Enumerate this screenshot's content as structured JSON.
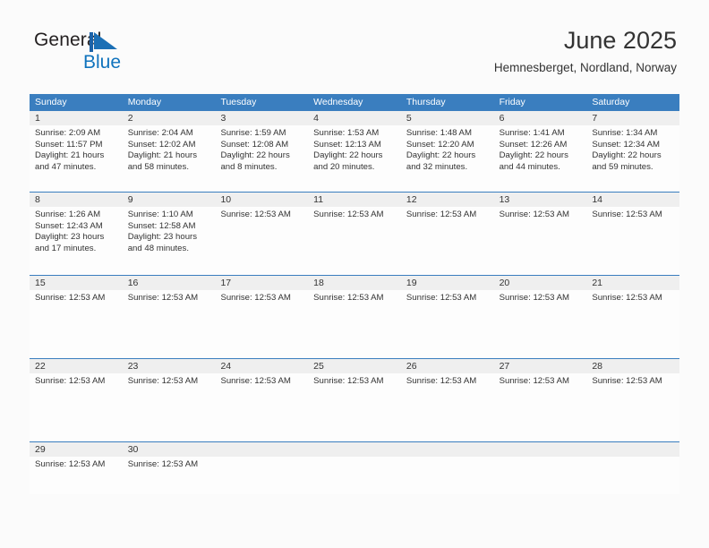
{
  "brand": {
    "name_part1": "General",
    "name_part2": "Blue",
    "flag_icon": "blue-triangle-flag-icon",
    "color_primary": "#1073bd",
    "color_text": "#231f20"
  },
  "header": {
    "title": "June 2025",
    "location": "Hemnesberget, Nordland, Norway"
  },
  "colors": {
    "header_blue": "#3a7ebf",
    "row_divider": "#3a7ebf",
    "daynum_band": "#efefef",
    "page_background": "#fbfbfb",
    "text": "#333333"
  },
  "weekdays": [
    "Sunday",
    "Monday",
    "Tuesday",
    "Wednesday",
    "Thursday",
    "Friday",
    "Saturday"
  ],
  "weeks": [
    {
      "days": [
        {
          "date": "1",
          "lines": [
            "Sunrise: 2:09 AM",
            "Sunset: 11:57 PM",
            "Daylight: 21 hours",
            "and 47 minutes."
          ]
        },
        {
          "date": "2",
          "lines": [
            "Sunrise: 2:04 AM",
            "Sunset: 12:02 AM",
            "Daylight: 21 hours",
            "and 58 minutes."
          ]
        },
        {
          "date": "3",
          "lines": [
            "Sunrise: 1:59 AM",
            "Sunset: 12:08 AM",
            "Daylight: 22 hours",
            "and 8 minutes."
          ]
        },
        {
          "date": "4",
          "lines": [
            "Sunrise: 1:53 AM",
            "Sunset: 12:13 AM",
            "Daylight: 22 hours",
            "and 20 minutes."
          ]
        },
        {
          "date": "5",
          "lines": [
            "Sunrise: 1:48 AM",
            "Sunset: 12:20 AM",
            "Daylight: 22 hours",
            "and 32 minutes."
          ]
        },
        {
          "date": "6",
          "lines": [
            "Sunrise: 1:41 AM",
            "Sunset: 12:26 AM",
            "Daylight: 22 hours",
            "and 44 minutes."
          ]
        },
        {
          "date": "7",
          "lines": [
            "Sunrise: 1:34 AM",
            "Sunset: 12:34 AM",
            "Daylight: 22 hours",
            "and 59 minutes."
          ]
        }
      ]
    },
    {
      "days": [
        {
          "date": "8",
          "lines": [
            "Sunrise: 1:26 AM",
            "Sunset: 12:43 AM",
            "Daylight: 23 hours",
            "and 17 minutes."
          ]
        },
        {
          "date": "9",
          "lines": [
            "Sunrise: 1:10 AM",
            "Sunset: 12:58 AM",
            "Daylight: 23 hours",
            "and 48 minutes."
          ]
        },
        {
          "date": "10",
          "lines": [
            "Sunrise: 12:53 AM"
          ]
        },
        {
          "date": "11",
          "lines": [
            "Sunrise: 12:53 AM"
          ]
        },
        {
          "date": "12",
          "lines": [
            "Sunrise: 12:53 AM"
          ]
        },
        {
          "date": "13",
          "lines": [
            "Sunrise: 12:53 AM"
          ]
        },
        {
          "date": "14",
          "lines": [
            "Sunrise: 12:53 AM"
          ]
        }
      ]
    },
    {
      "days": [
        {
          "date": "15",
          "lines": [
            "Sunrise: 12:53 AM"
          ]
        },
        {
          "date": "16",
          "lines": [
            "Sunrise: 12:53 AM"
          ]
        },
        {
          "date": "17",
          "lines": [
            "Sunrise: 12:53 AM"
          ]
        },
        {
          "date": "18",
          "lines": [
            "Sunrise: 12:53 AM"
          ]
        },
        {
          "date": "19",
          "lines": [
            "Sunrise: 12:53 AM"
          ]
        },
        {
          "date": "20",
          "lines": [
            "Sunrise: 12:53 AM"
          ]
        },
        {
          "date": "21",
          "lines": [
            "Sunrise: 12:53 AM"
          ]
        }
      ]
    },
    {
      "days": [
        {
          "date": "22",
          "lines": [
            "Sunrise: 12:53 AM"
          ]
        },
        {
          "date": "23",
          "lines": [
            "Sunrise: 12:53 AM"
          ]
        },
        {
          "date": "24",
          "lines": [
            "Sunrise: 12:53 AM"
          ]
        },
        {
          "date": "25",
          "lines": [
            "Sunrise: 12:53 AM"
          ]
        },
        {
          "date": "26",
          "lines": [
            "Sunrise: 12:53 AM"
          ]
        },
        {
          "date": "27",
          "lines": [
            "Sunrise: 12:53 AM"
          ]
        },
        {
          "date": "28",
          "lines": [
            "Sunrise: 12:53 AM"
          ]
        }
      ]
    },
    {
      "days": [
        {
          "date": "29",
          "lines": [
            "Sunrise: 12:53 AM"
          ]
        },
        {
          "date": "30",
          "lines": [
            "Sunrise: 12:53 AM"
          ]
        },
        {
          "date": "",
          "lines": []
        },
        {
          "date": "",
          "lines": []
        },
        {
          "date": "",
          "lines": []
        },
        {
          "date": "",
          "lines": []
        },
        {
          "date": "",
          "lines": []
        }
      ]
    }
  ]
}
